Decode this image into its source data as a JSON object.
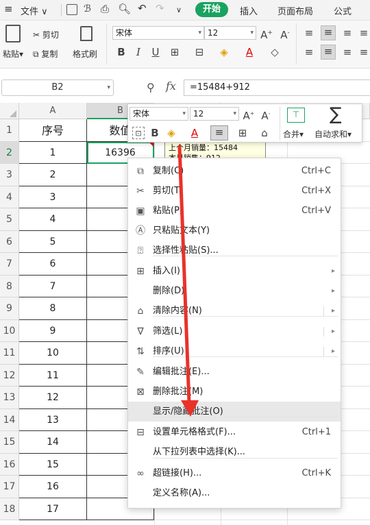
{
  "menubar": {
    "file": "文件",
    "tab_start": "开始",
    "tab_insert": "插入",
    "tab_layout": "页面布局",
    "tab_formula": "公式"
  },
  "ribbon": {
    "paste": "粘贴",
    "cut": "剪切",
    "copy": "复制",
    "format_painter": "格式刷",
    "font_name": "宋体",
    "font_size": "12"
  },
  "formula_bar": {
    "cell_ref": "B2",
    "fx": "fx",
    "formula": "=15484+912"
  },
  "grid": {
    "col_a": "A",
    "col_b": "B",
    "rows": [
      "1",
      "2",
      "3",
      "4",
      "5",
      "6",
      "7",
      "8",
      "9",
      "10",
      "11",
      "12",
      "13",
      "14",
      "15",
      "16",
      "17",
      "18"
    ],
    "a_values": [
      "序号",
      "1",
      "2",
      "3",
      "4",
      "5",
      "6",
      "7",
      "8",
      "9",
      "10",
      "11",
      "12",
      "13",
      "14",
      "15",
      "16",
      "17"
    ],
    "b1": "数值",
    "b2": "16396"
  },
  "comment": {
    "line1": "上个月销量：15484",
    "line2": "本月销售：912"
  },
  "mini_toolbar": {
    "font_name": "宋体",
    "font_size": "12",
    "merge": "合并",
    "autosum": "自动求和"
  },
  "context_menu": {
    "items": [
      {
        "label": "复制(C)",
        "shortcut": "Ctrl+C",
        "icon": "copy-icon"
      },
      {
        "label": "剪切(T)",
        "shortcut": "Ctrl+X",
        "icon": "scissors-icon"
      },
      {
        "label": "粘贴(P)",
        "shortcut": "Ctrl+V",
        "icon": "paste-icon"
      },
      {
        "label": "只粘贴文本(Y)",
        "shortcut": "",
        "icon": "paste-text-icon"
      },
      {
        "label": "选择性粘贴(S)...",
        "shortcut": "",
        "icon": "paste-special-icon"
      },
      {
        "label": "插入(I)",
        "shortcut": "",
        "icon": "insert-icon"
      },
      {
        "label": "删除(D)",
        "shortcut": "",
        "icon": ""
      },
      {
        "label": "清除内容(N)",
        "shortcut": "",
        "icon": "eraser-icon"
      },
      {
        "label": "筛选(L)",
        "shortcut": "",
        "icon": "filter-icon"
      },
      {
        "label": "排序(U)",
        "shortcut": "",
        "icon": "sort-icon"
      },
      {
        "label": "编辑批注(E)...",
        "shortcut": "",
        "icon": "edit-comment-icon"
      },
      {
        "label": "删除批注(M)",
        "shortcut": "",
        "icon": "delete-comment-icon"
      },
      {
        "label": "显示/隐藏批注(O)",
        "shortcut": "",
        "icon": ""
      },
      {
        "label": "设置单元格格式(F)...",
        "shortcut": "Ctrl+1",
        "icon": "format-cells-icon"
      },
      {
        "label": "从下拉列表中选择(K)...",
        "shortcut": "",
        "icon": ""
      },
      {
        "label": "超链接(H)...",
        "shortcut": "Ctrl+K",
        "icon": "link-icon"
      },
      {
        "label": "定义名称(A)...",
        "shortcut": "",
        "icon": ""
      }
    ]
  },
  "colors": {
    "accent": "#1aa260",
    "arrow": "#e8322a",
    "highlight": "#e8e8e8",
    "comment_bg": "#ffffe1"
  }
}
